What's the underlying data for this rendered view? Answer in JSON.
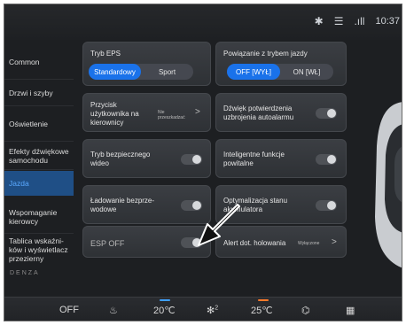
{
  "status": {
    "bluetooth_icon": "bluetooth-icon",
    "wifi_icon": "wifi-icon",
    "signal_icon": "signal-icon",
    "time": "10:37"
  },
  "sidebar": {
    "items": [
      {
        "label": "Common",
        "active": false
      },
      {
        "label": "Drzwi i szyby",
        "active": false
      },
      {
        "label": "Oświetlenie",
        "active": false
      },
      {
        "label": "Efekty dźwiękowe samochodu",
        "active": false
      },
      {
        "label": "Jazda",
        "active": true
      },
      {
        "label": "Wspomaganie kierowcy",
        "active": false
      },
      {
        "label": "Tablica wskaźni-ków i wyświetlacz przezierny",
        "active": false
      }
    ],
    "brand": "DENZA"
  },
  "cards": {
    "eps": {
      "title": "Tryb EPS",
      "options": [
        "Standardowy",
        "Sport"
      ],
      "selected": 0
    },
    "link": {
      "title": "Powiązanie z trybem jazdy",
      "options": [
        "OFF [WYŁ]",
        "ON [WŁ]"
      ],
      "selected": 0
    },
    "user_button": {
      "label": "Przycisk użytkownika na kierownicy",
      "value": "Nie przeszkadzać"
    },
    "alarm_sound": {
      "label": "Dźwięk potwierdzenia uzbrojenia autoalarmu",
      "on": false
    },
    "safe_video": {
      "label": "Tryb bezpiecznego wideo",
      "on": false
    },
    "smart_welcome": {
      "label": "Inteligentne funkcje powitalne",
      "on": false
    },
    "wireless_charge": {
      "label": "Ładowanie bezprze-wodowe",
      "on": false
    },
    "battery_opt": {
      "label": "Optymalizacja stanu akumulatora",
      "on": false
    },
    "esp": {
      "label": "ESP OFF",
      "on": false
    },
    "tow_alert": {
      "label": "Alert dot. holowania",
      "value": "Wyłączone"
    }
  },
  "climate": {
    "off_label": "OFF",
    "left_temp": "20℃",
    "fan_level": "2",
    "right_temp": "25℃",
    "left_accent": "#3fa0ff",
    "right_accent": "#ff7a2a"
  }
}
